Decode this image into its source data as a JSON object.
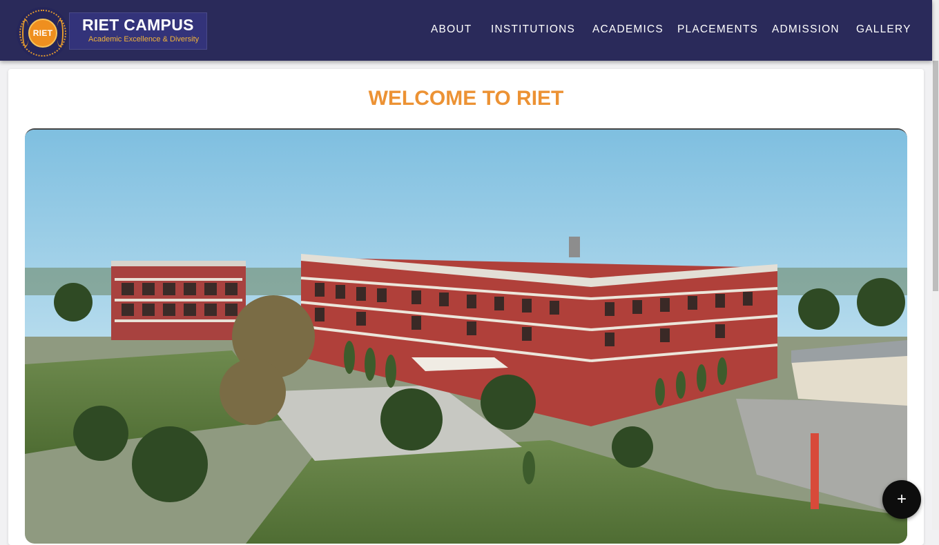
{
  "header": {
    "logo_seal_text": "RIET",
    "brand_title": "RIET CAMPUS",
    "brand_subtitle": "Academic Excellence & Diversity",
    "nav": [
      "ABOUT",
      "INSTITUTIONS",
      "ACADEMICS",
      "PLACEMENTS",
      "ADMISSION",
      "GALLERY"
    ]
  },
  "main": {
    "welcome_title": "WELCOME TO RIET",
    "hero_image": "campus-aerial-photo"
  },
  "fab": {
    "icon": "plus-icon",
    "symbol": "+"
  },
  "colors": {
    "header_bg": "#2a2a5a",
    "accent_orange": "#ec9234",
    "brand_subtitle": "#f2b33a"
  }
}
